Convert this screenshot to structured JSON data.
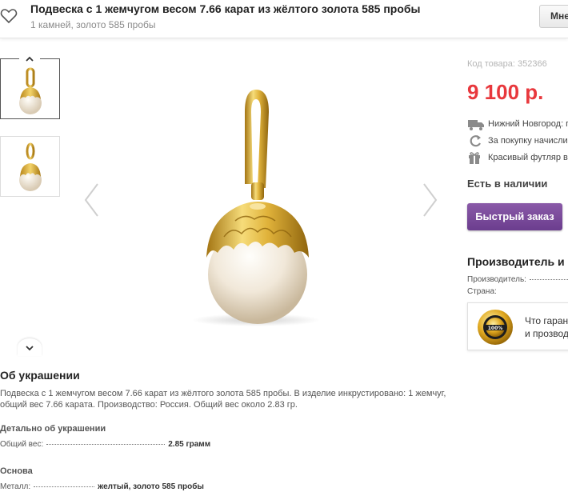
{
  "header": {
    "title": "Подвеска с 1 жемчугом весом 7.66 карат из жёлтого золота 585 пробы",
    "subtitle": "1 камней, золото 585 пробы",
    "button_label": "Мне",
    "favorite_icon": "heart-icon"
  },
  "gallery": {
    "thumbnails": [
      {
        "alt": "pendant-front"
      },
      {
        "alt": "pendant-side"
      }
    ],
    "up_icon": "chevron-up-icon",
    "down_icon": "chevron-down-icon",
    "prev_icon": "chevron-left-icon",
    "next_icon": "chevron-right-icon"
  },
  "product": {
    "sku_text": "Код товара: 352366",
    "price": "9 100 р.",
    "features": [
      {
        "icon": "truck-icon",
        "text": "Нижний Новгород: г"
      },
      {
        "icon": "refresh-icon",
        "text": "За покупку начисли"
      },
      {
        "icon": "gift-icon",
        "text": "Красивый футляр в"
      }
    ],
    "stock": "Есть в наличии",
    "quick_order": "Быстрый заказ"
  },
  "manufacturer": {
    "title": "Производитель и",
    "rows": [
      {
        "label": "Производитель:"
      },
      {
        "label": "Страна:"
      }
    ],
    "guarantee_line1": "Что гаран",
    "guarantee_line2": "и прозвод"
  },
  "about": {
    "title": "Об украшении",
    "text": "Подвеска с 1 жемчугом весом 7.66 карат из жёлтого золота 585 пробы. В изделие инкрустировано: 1 жемчуг, общий вес 7.66 карата. Производство: Россия. Общий вес около 2.83 гр.",
    "details_title": "Детально об украшении",
    "weight_label": "Общий вес:",
    "weight_value": "2.85 грамм",
    "base_title": "Основа",
    "metal_label": "Металл:",
    "metal_value": "желтый, золото 585 пробы"
  },
  "colors": {
    "price": "#e8383d",
    "button": "#7b4c9c",
    "gold": "#d4a72c",
    "pearl": "#f4ece0"
  }
}
